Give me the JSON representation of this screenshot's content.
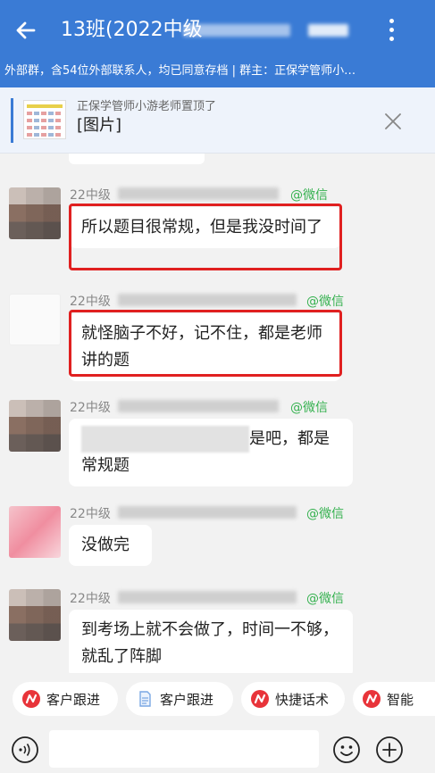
{
  "header": {
    "title": "13班(2022中级",
    "subtitle": "外部群，含54位外部联系人，均已同意存档 | 群主：正保学管师小…"
  },
  "pinned": {
    "by": "正保学管师小游老师置顶了",
    "content": "[图片]"
  },
  "messages": [
    {
      "sender": "22中级",
      "source": "@微信",
      "text": "所以题目很常规，但是我没时间了",
      "highlighted": true
    },
    {
      "sender": "22中级",
      "source": "@微信",
      "text": "就怪脑子不好，记不住，都是老师讲的题",
      "highlighted": true
    },
    {
      "sender": "22中级",
      "source": "@微信",
      "text_line1": "是吧，都是",
      "text_line2": "常规题",
      "highlighted": false
    },
    {
      "sender": "22中级",
      "source": "@微信",
      "text": "没做完",
      "highlighted": false
    },
    {
      "sender": "22中级",
      "source": "@微信",
      "text": "到考场上就不会做了，时间一不够，就乱了阵脚",
      "highlighted": false
    }
  ],
  "quick_actions": [
    "客户跟进",
    "客户跟进",
    "快捷话术",
    "智能"
  ],
  "input": {
    "value": ""
  },
  "icons": {
    "back": "back-arrow-icon",
    "more": "more-vertical-icon",
    "close": "close-icon",
    "voice": "voice-icon",
    "emoji": "emoji-icon",
    "plus": "plus-icon",
    "action": "brand-badge-icon",
    "doc": "document-icon"
  },
  "colors": {
    "header": "#3a7bd5",
    "highlight": "#e02020",
    "wechat_tag": "#35b14f",
    "badge": "#e8343a"
  }
}
